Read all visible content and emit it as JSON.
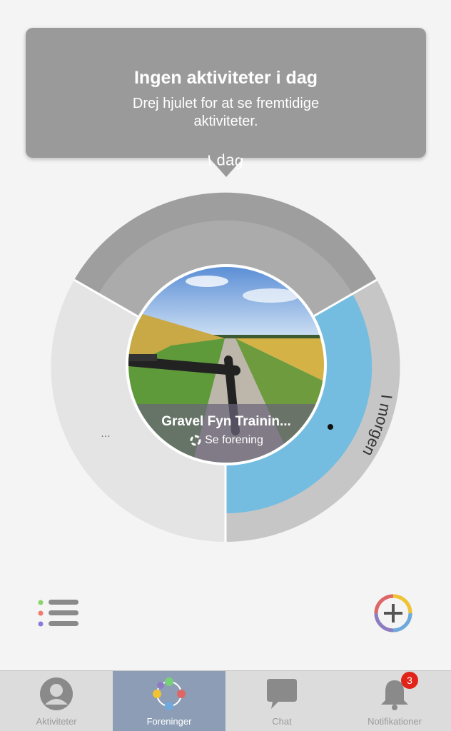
{
  "tooltip": {
    "title": "Ingen aktiviteter i dag",
    "subtitle": "Drej hjulet for at se fremtidige aktiviteter."
  },
  "wheel": {
    "segments": {
      "today_label": "I dag",
      "tomorrow_label": "I morgen",
      "more_label": "..."
    },
    "colors": {
      "today": "#9e9e9e",
      "tomorrow_ring": "#c8c8c8",
      "tomorrow_fill": "#74bde0",
      "other": "#e4e4e4"
    }
  },
  "featured_club": {
    "name": "Gravel Fyn Trainin...",
    "link_label": "Se forening"
  },
  "nav": {
    "items": [
      {
        "label": "Aktiviteter",
        "icon": "person-icon",
        "active": false
      },
      {
        "label": "Foreninger",
        "icon": "club-ring-icon",
        "active": true
      },
      {
        "label": "Chat",
        "icon": "chat-bubble-icon",
        "active": false
      },
      {
        "label": "Notifikationer",
        "icon": "bell-icon",
        "active": false,
        "badge": "3"
      }
    ]
  },
  "actions": {
    "list_icon": "list-icon",
    "add_icon": "add-icon"
  }
}
